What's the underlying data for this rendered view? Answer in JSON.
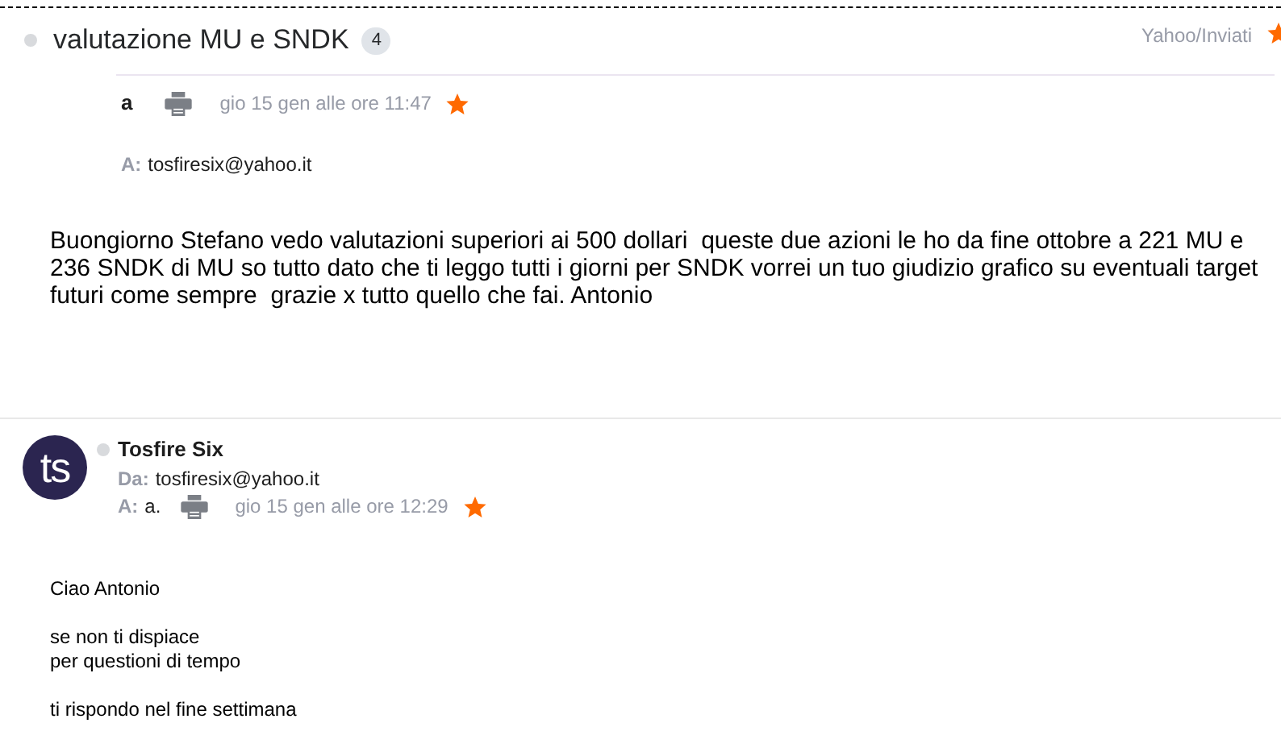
{
  "thread": {
    "subject": "valutazione MU e SNDK",
    "count": "4",
    "folder": "Yahoo/Inviati",
    "starred": true
  },
  "messages": [
    {
      "kind": "collapsed",
      "sender": "a",
      "date": "gio 15 gen alle ore 11:47",
      "starred": true,
      "to_label": "A:",
      "to": "tosfiresix@yahoo.it",
      "body": [
        "Buongiorno Stefano vedo valutazioni superiori ai 500 dollari  queste due azioni le ho da fine ottobre a 221 MU e 236 SNDK di MU so tutto dato che ti leggo tutti i giorni per SNDK vorrei un tuo giudizio grafico su eventuali target futuri come sempre  grazie x tutto quello che fai. Antonio"
      ]
    },
    {
      "kind": "full",
      "avatar": "ts",
      "sender": "Tosfire Six",
      "from_label": "Da:",
      "from": "tosfiresix@yahoo.it",
      "to_label": "A:",
      "to": "a.",
      "date": "gio 15 gen alle ore 12:29",
      "starred": true,
      "body": [
        "Ciao Antonio",
        "se non ti dispiace\nper questioni di tempo",
        "ti rispondo nel fine settimana"
      ]
    }
  ]
}
